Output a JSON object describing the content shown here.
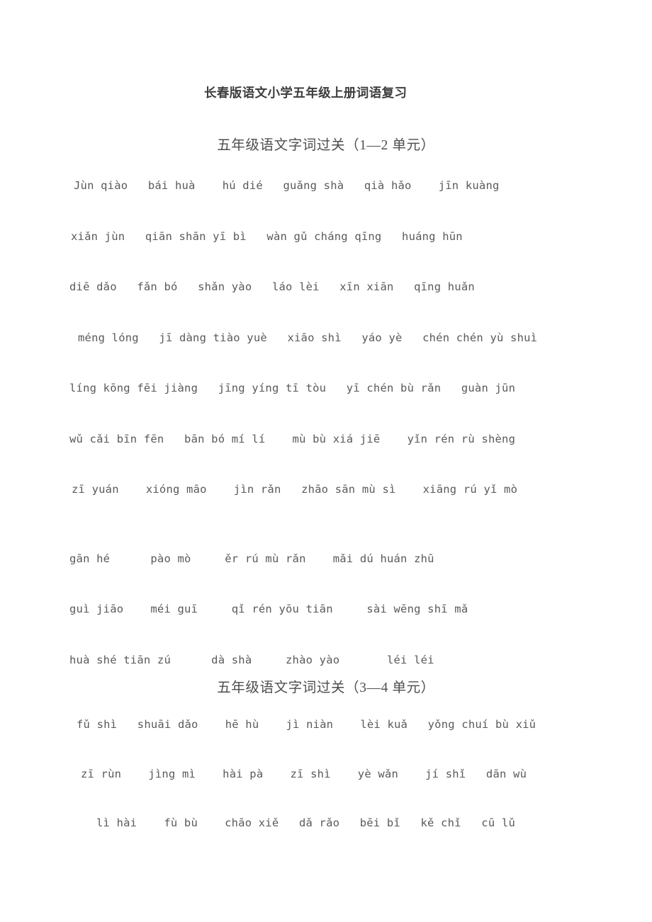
{
  "document": {
    "title": "长春版语文小学五年级上册词语复习",
    "text_color": "#4a4a4a",
    "background_color": "#ffffff"
  },
  "sections": [
    {
      "heading": "五年级语文字词过关（1—2 单元）",
      "rows": [
        "Jùn qiào   bái huà    hú dié   guǎng shà   qià hǎo    jīn kuàng",
        "xiǎn jùn   qiān shān yī bì   wàn gǔ cháng qīng   huáng hūn",
        "diē dǎo   fǎn bó   shǎn yào   láo lèi   xīn xiān   qīng huǎn",
        "méng lóng   jī dàng tiào yuè   xiāo shì   yáo yè   chén chén yù shuì",
        "líng kōng fēi jiàng   jīng yíng tī tòu   yī chén bù rǎn   guàn jūn",
        "wǔ cǎi bīn fēn   bān bó mí lí    mù bù xiá jiē    yǐn rén rù shèng",
        "zī yuán    xióng māo    jìn rǎn   zhāo sān mù sì    xiāng rú yǐ mò",
        "gān hé      pào mò     ěr rú mù rǎn    mǎi dú huán zhū",
        "guì jiāo    méi guī     qǐ rén yōu tiān     sài wēng shī mǎ",
        "huà shé tiān zú      dà shà     zhào yào       léi léi"
      ]
    },
    {
      "heading": "五年级语文字词过关（3—4 单元）",
      "rows": [
        "fǔ shì   shuāi dǎo    hē hù    jì niàn    lèi kuǎ   yǒng chuí bù xiǔ",
        "zī rùn    jìng mì    hài pà    zī shì    yè wǎn    jí shǐ   dān wù",
        "lì hài    fù bù    chāo xiě   dǎ rǎo   bēi bǐ   kě chǐ   cū lǔ"
      ]
    }
  ]
}
